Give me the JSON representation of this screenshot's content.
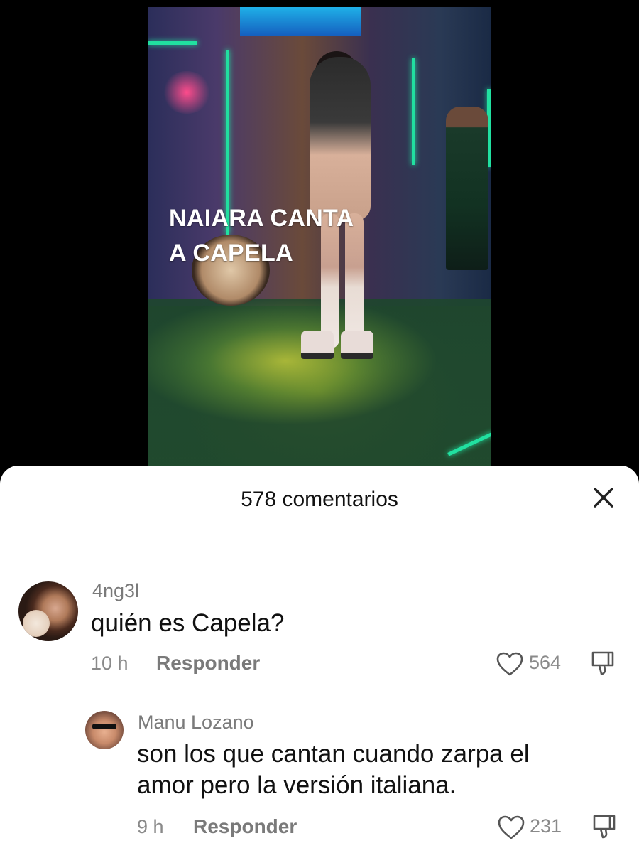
{
  "video": {
    "caption_line1": "NAIARA CANTA",
    "caption_line2": "A CAPELA"
  },
  "comments_panel": {
    "title": "578 comentarios",
    "close_icon": "close-icon"
  },
  "comments": [
    {
      "username": "4ng3l",
      "text": "quién es Capela?",
      "time": "10 h",
      "reply_label": "Responder",
      "likes": "564"
    },
    {
      "username": "Manu Lozano",
      "text_line1": "son los que cantan cuando zarpa el",
      "text_line2": "amor pero la versión italiana.",
      "time": "9 h",
      "reply_label": "Responder",
      "likes": "231"
    }
  ],
  "icons": {
    "like": "heart-outline-icon",
    "dislike": "thumbs-down-icon"
  },
  "colors": {
    "background": "#000000",
    "sheet": "#ffffff",
    "caption_text": "#ffffff",
    "secondary_text": "#8a8a8a"
  }
}
